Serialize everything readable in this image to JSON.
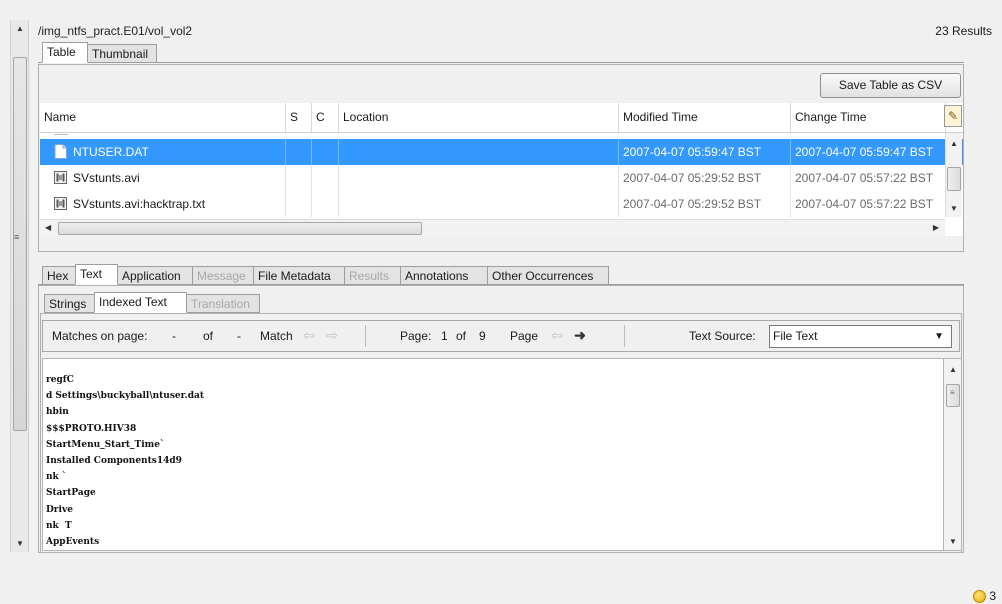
{
  "header": {
    "path": "/img_ntfs_pract.E01/vol_vol2",
    "results": "23 Results"
  },
  "view_tabs": [
    {
      "label": "Table"
    },
    {
      "label": "Thumbnail"
    }
  ],
  "toolbar_top": {
    "save_csv": "Save Table as CSV"
  },
  "table": {
    "columns": [
      "Name",
      "S",
      "C",
      "Location",
      "Modified Time",
      "Change Time"
    ],
    "rows": [
      {
        "name": "NTUSER.DAT",
        "s": "",
        "c": "",
        "location": "",
        "modified": "2007-04-07 05:59:47 BST",
        "changed": "2007-04-07 05:59:47 BST",
        "selected": true,
        "icon": "file-icon"
      },
      {
        "name": "SVstunts.avi",
        "s": "",
        "c": "",
        "location": "",
        "modified": "2007-04-07 05:29:52 BST",
        "changed": "2007-04-07 05:57:22 BST",
        "selected": false,
        "icon": "video-file-icon"
      },
      {
        "name": "SVstunts.avi:hacktrap.txt",
        "s": "",
        "c": "",
        "location": "",
        "modified": "2007-04-07 05:29:52 BST",
        "changed": "2007-04-07 05:57:22 BST",
        "selected": false,
        "icon": "video-file-icon"
      }
    ]
  },
  "content_tabs": [
    {
      "label": "Hex",
      "state": "normal"
    },
    {
      "label": "Text",
      "state": "active"
    },
    {
      "label": "Application",
      "state": "normal"
    },
    {
      "label": "Message",
      "state": "disabled"
    },
    {
      "label": "File Metadata",
      "state": "normal"
    },
    {
      "label": "Results",
      "state": "disabled"
    },
    {
      "label": "Annotations",
      "state": "normal"
    },
    {
      "label": "Other Occurrences",
      "state": "normal"
    }
  ],
  "text_subtabs": [
    {
      "label": "Strings",
      "state": "normal"
    },
    {
      "label": "Indexed Text",
      "state": "active"
    },
    {
      "label": "Translation",
      "state": "disabled"
    }
  ],
  "search_bar": {
    "matches_label": "Matches on page:",
    "matches_current": "-",
    "of_label": "of",
    "matches_total": "-",
    "match_label": "Match",
    "page_label": "Page:",
    "page_current": "1",
    "page_of_label": "of",
    "page_total": "9",
    "page_nav_label": "Page",
    "text_source_label": "Text Source:",
    "text_source_value": "File Text"
  },
  "text_content": [
    "regfC",
    "d Settings\\buckyball\\ntuser.dat",
    "hbin",
    "$$$PROTO.HIV38",
    "StartMenu_Start_Time`",
    "Installed Components14d9",
    "nk `",
    "StartPage",
    "Drive",
    "nk  T",
    "AppEvents"
  ],
  "status": {
    "notification_count": "3"
  },
  "colors": {
    "selection": "#3399ff",
    "background": "#f0f0f0"
  }
}
